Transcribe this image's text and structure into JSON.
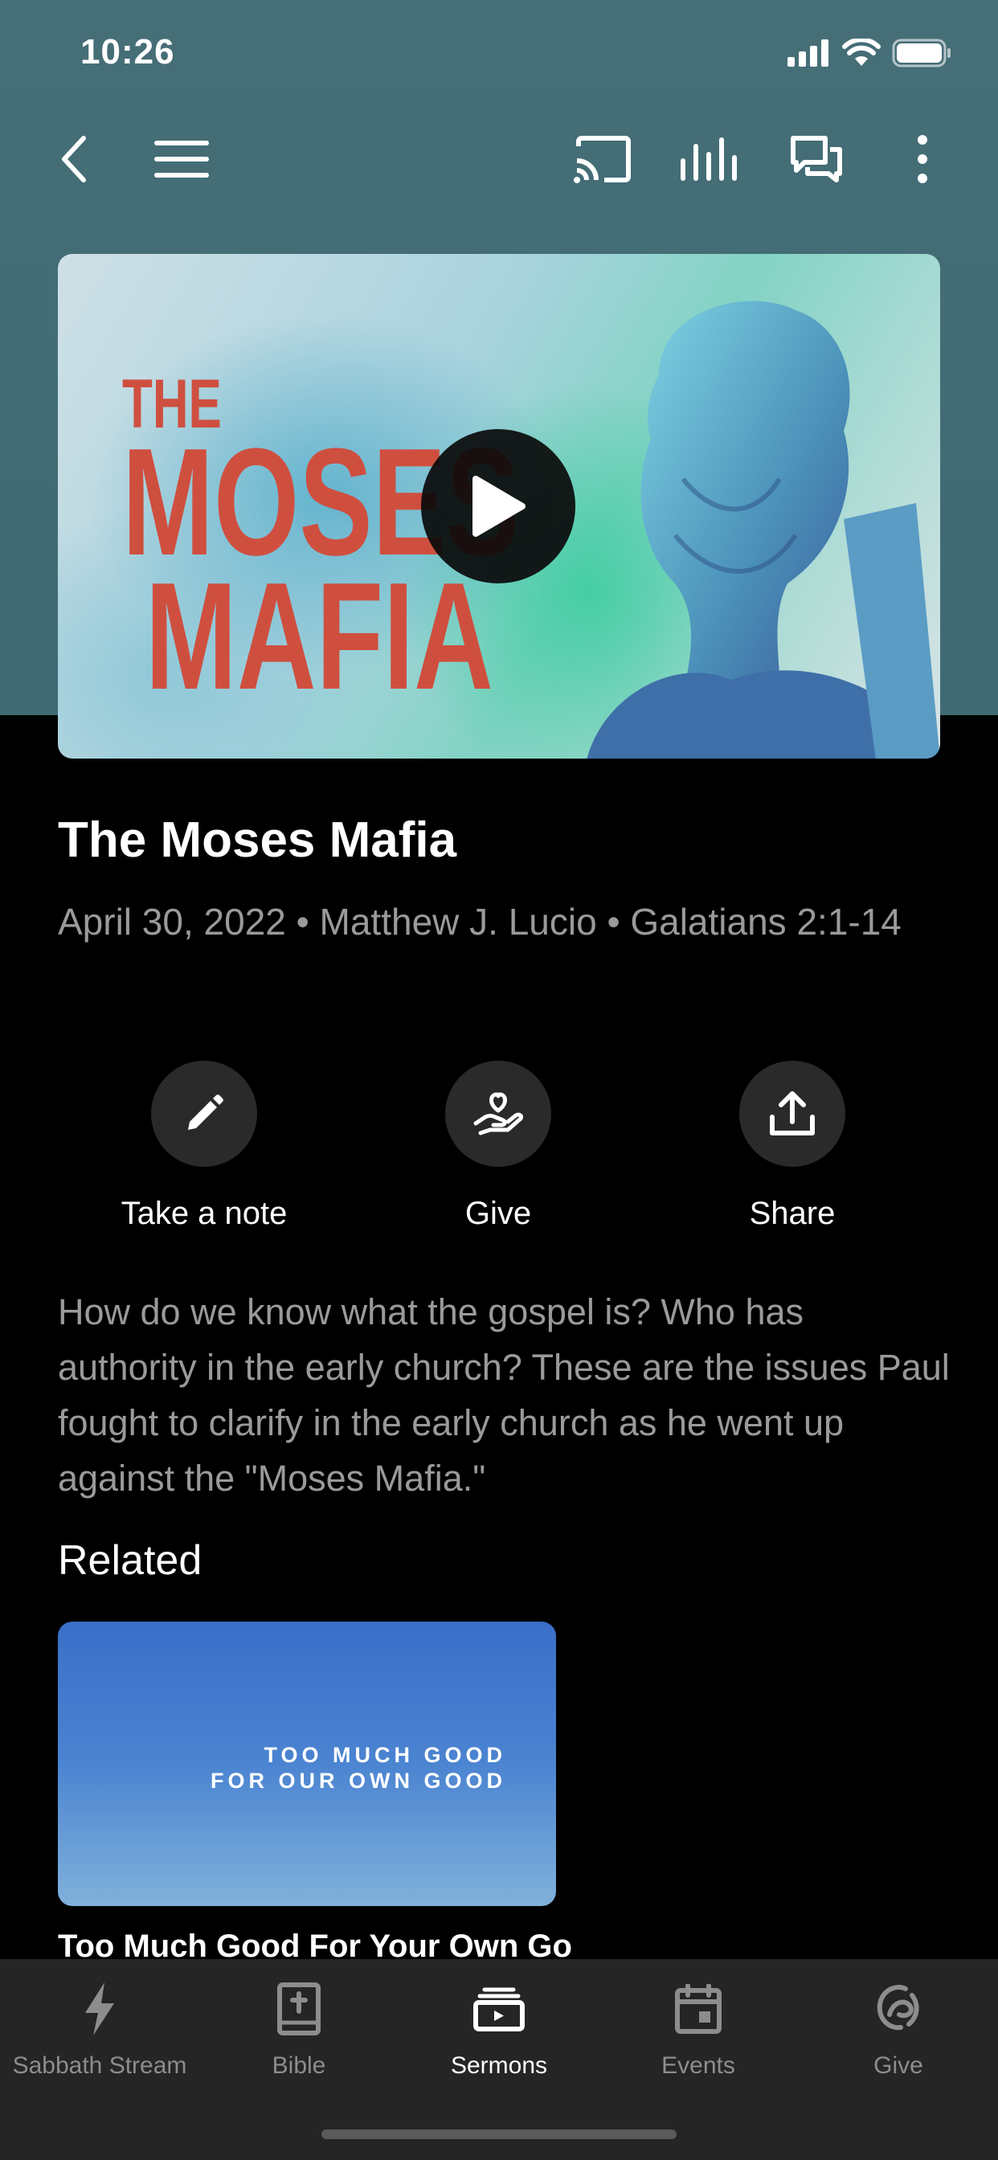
{
  "status_bar": {
    "time": "10:26"
  },
  "nav": {
    "back": "back-icon",
    "menu": "hamburger-menu-icon",
    "cast": "cast-icon",
    "audio": "audio-bars-icon",
    "chat": "chat-bubbles-icon",
    "more": "more-vertical-icon"
  },
  "hero": {
    "title_line1": "THE",
    "title_line2": "MOSES",
    "title_line3": "MAFIA",
    "play": "play-icon"
  },
  "sermon": {
    "title": "The Moses Mafia",
    "meta": "April 30, 2022 • Matthew J. Lucio • Galatians 2:1-14",
    "description": "How do we know what the gospel is? Who has authority in the early church? These are the issues Paul fought to clarify in the early church as he went up against the \"Moses Mafia.\""
  },
  "actions": [
    {
      "label": "Take a note",
      "icon": "pencil-icon"
    },
    {
      "label": "Give",
      "icon": "hand-heart-icon"
    },
    {
      "label": "Share",
      "icon": "share-upload-icon"
    }
  ],
  "related": {
    "heading": "Related",
    "card_line1": "TOO MUCH GOOD",
    "card_line2": "FOR OUR OWN GOOD",
    "card_title": "Too Much Good For Your Own Good"
  },
  "tabs": [
    {
      "label": "Sabbath Stream",
      "icon": "lightning-icon",
      "active": false
    },
    {
      "label": "Bible",
      "icon": "bible-icon",
      "active": false
    },
    {
      "label": "Sermons",
      "icon": "sermons-icon",
      "active": true
    },
    {
      "label": "Events",
      "icon": "calendar-icon",
      "active": false
    },
    {
      "label": "Give",
      "icon": "give-icon",
      "active": false
    }
  ],
  "colors": {
    "teal_header": "#466e77",
    "title_red": "#cf4f3f",
    "tab_bar": "#252525",
    "muted_text": "#9a9a9a"
  }
}
